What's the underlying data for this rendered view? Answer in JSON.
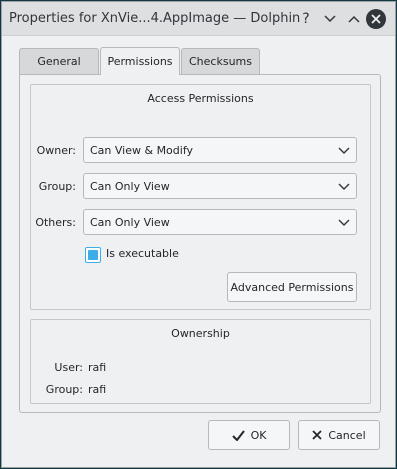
{
  "window": {
    "title": "Properties for XnVie...4.AppImage — Dolphin",
    "controls": {
      "help": "?"
    }
  },
  "tabs": [
    {
      "label": "General"
    },
    {
      "label": "Permissions"
    },
    {
      "label": "Checksums"
    }
  ],
  "access": {
    "title": "Access Permissions",
    "owner": {
      "label": "Owner:",
      "value": "Can View & Modify"
    },
    "group": {
      "label": "Group:",
      "value": "Can Only View"
    },
    "others": {
      "label": "Others:",
      "value": "Can Only View"
    },
    "executable": {
      "label": "Is executable",
      "checked": true
    },
    "advanced_button": "Advanced Permissions"
  },
  "ownership": {
    "title": "Ownership",
    "user": {
      "label": "User:",
      "value": "rafi"
    },
    "group": {
      "label": "Group:",
      "value": "rafi"
    }
  },
  "buttons": {
    "ok": "OK",
    "cancel": "Cancel"
  },
  "colors": {
    "accent": "#3daee9",
    "window_bg": "#eff0f1",
    "titlebar_bg": "#dedfe1"
  }
}
